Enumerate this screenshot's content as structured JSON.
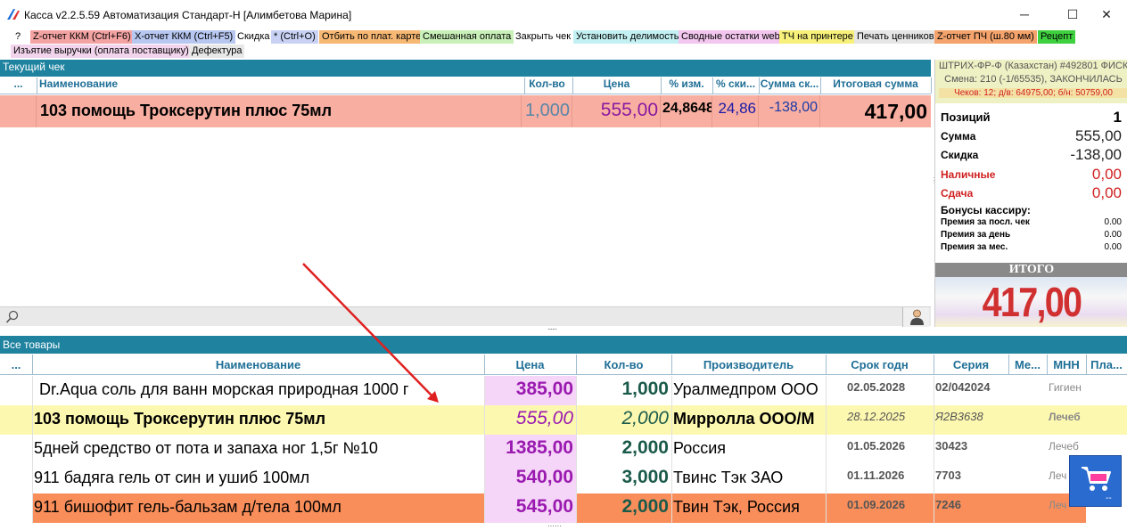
{
  "window": {
    "title": "Касса v2.2.5.59 Автоматизация Стандарт-Н [Алимбетова Марина]",
    "minimize": "─",
    "maximize": "☐",
    "close": "✕"
  },
  "toolbar": {
    "row1": [
      {
        "label": "?",
        "bg": "#ffffff"
      },
      {
        "label": "Z-отчет ККМ (Ctrl+F6)",
        "bg": "#f4a3a3"
      },
      {
        "label": "X-отчет ККМ (Ctrl+F5)",
        "bg": "#b7c7f0"
      },
      {
        "label": "Скидка",
        "bg": "#ffffff"
      },
      {
        "label": "* (Ctrl+O)",
        "bg": "#c9d2f5"
      },
      {
        "label": "Отбить по плат. карте",
        "bg": "#f7b874"
      },
      {
        "label": "Смешанная оплата",
        "bg": "#c8f0b8"
      },
      {
        "label": "Закрыть чек",
        "bg": "#ffffff"
      },
      {
        "label": "Установить делимость",
        "bg": "#c3f0f2"
      },
      {
        "label": "Сводные остатки web",
        "bg": "#f2c6ee"
      },
      {
        "label": "ТЧ на принтере",
        "bg": "#f7f07a"
      },
      {
        "label": "Печать ценников",
        "bg": "#e6e6e6"
      },
      {
        "label": "Z-отчет ПЧ (ш.80 мм)",
        "bg": "#f4a36c"
      },
      {
        "label": "Рецепт",
        "bg": "#3fd03f"
      }
    ],
    "row2": [
      {
        "label": "Изъятие выручки (оплата поставщику)",
        "bg": "#f2d4ec"
      },
      {
        "label": "Дефектура",
        "bg": "#e8e8e8"
      }
    ]
  },
  "current_check": {
    "header": "Текущий чек",
    "columns": [
      "...",
      "Наименование",
      "Кол-во",
      "Цена",
      "% изм.",
      "% ски...",
      "Сумма ск...",
      "Итоговая сумма"
    ],
    "row": {
      "name": "103 помощь Троксерутин плюс 75мл",
      "qty": "1,000",
      "price": "555,00",
      "pct_change": "24,8648",
      "pct_discount": "24,86",
      "discount_sum": "-138,00",
      "total": "417,00"
    }
  },
  "fiscal": {
    "device": "ШТРИХ-ФР-Ф (Казахстан) #492801 ФИСК",
    "shift": "Смена: 210 (-1/65535), ЗАКОНЧИЛАСЬ",
    "checks": "Чеков: 12; д/в: 64975,00; б/н: 50759,00"
  },
  "summary": {
    "positions_label": "Позиций",
    "positions_value": "1",
    "sum_label": "Сумма",
    "sum_value": "555,00",
    "discount_label": "Скидка",
    "discount_value": "-138,00",
    "cash_label": "Наличные",
    "cash_value": "0,00",
    "change_label": "Сдача",
    "change_value": "0,00",
    "bonus_title": "Бонусы кассиру:",
    "bonus_last_label": "Премия за посл. чек",
    "bonus_last_value": "0.00",
    "bonus_day_label": "Премия за день",
    "bonus_day_value": "0.00",
    "bonus_month_label": "Премия за мес.",
    "bonus_month_value": "0.00",
    "total_label": "ИТОГО",
    "total_value": "417,00"
  },
  "all_goods": {
    "header": "Все товары",
    "columns": [
      "...",
      "Наименование",
      "Цена",
      "Кол-во",
      "Производитель",
      "Срок годн",
      "Серия",
      "Ме...",
      "МНН",
      "Пла..."
    ],
    "rows": [
      {
        "name": "Dr.Aqua соль для ванн морская природная 1000 г",
        "price": "385,00",
        "qty": "1,000",
        "maker": "Уралмедпром ООО",
        "expiry": "02.05.2028",
        "series": "02/042024",
        "mnn": "Гигиен"
      },
      {
        "name": "103 помощь Троксерутин плюс 75мл",
        "price": "555,00",
        "qty": "2,000",
        "maker": "Мирролла ООО/М",
        "expiry": "28.12.2025",
        "series": "Я2В3638",
        "mnn": "Лечеб"
      },
      {
        "name": "5дней средство от пота и запаха ног 1,5г №10",
        "price": "1385,00",
        "qty": "2,000",
        "maker": "Россия",
        "expiry": "01.05.2026",
        "series": "30423",
        "mnn": "Лечеб"
      },
      {
        "name": "911 бадяга гель от син и ушиб 100мл",
        "price": "540,00",
        "qty": "3,000",
        "maker": "Твинс Тэк ЗАО",
        "expiry": "01.11.2026",
        "series": "7703",
        "mnn": "Леч"
      },
      {
        "name": "911 бишофит гель-бальзам д/тела 100мл",
        "price": "545,00",
        "qty": "2,000",
        "maker": "Твин Тэк, Россия",
        "expiry": "01.09.2026",
        "series": "7246",
        "mnn": "Леч"
      }
    ]
  },
  "icons": {
    "search": "search-icon",
    "user": "user-icon",
    "cart": "cart-icon"
  }
}
